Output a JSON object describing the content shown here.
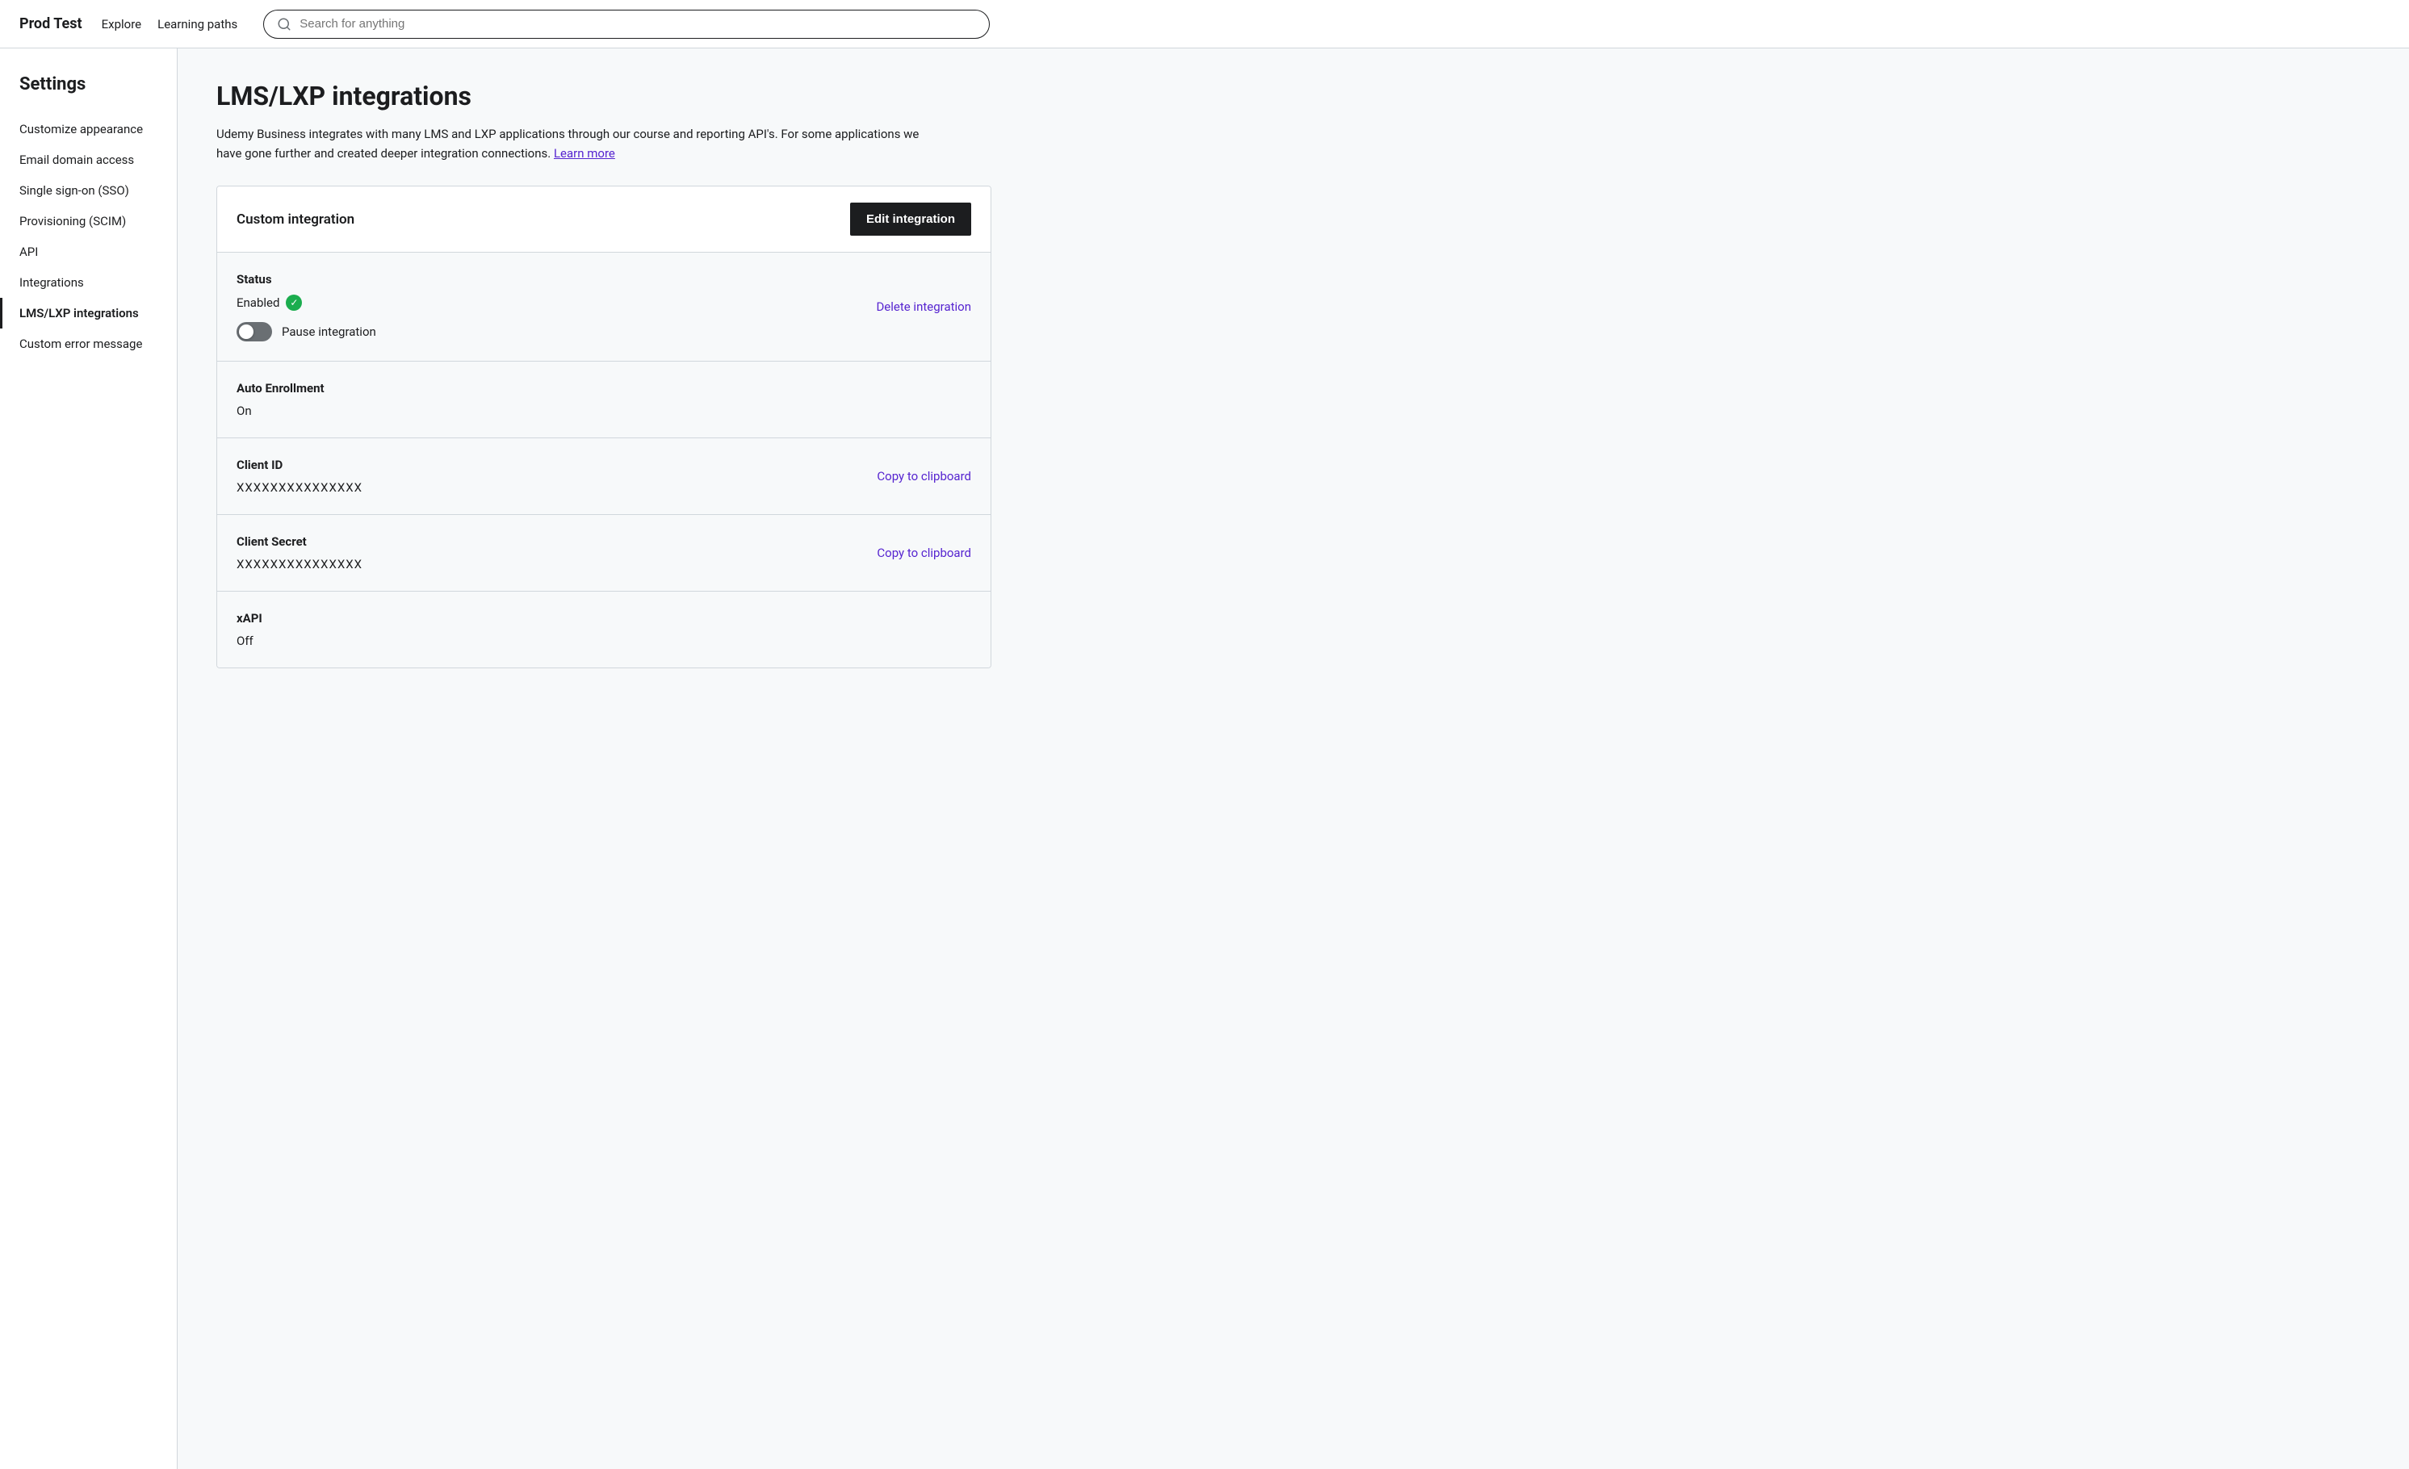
{
  "nav": {
    "brand": "Prod Test",
    "links": [
      "Explore",
      "Learning paths"
    ],
    "search_placeholder": "Search for anything"
  },
  "sidebar": {
    "title": "Settings",
    "items": [
      {
        "label": "Customize appearance",
        "active": false
      },
      {
        "label": "Email domain access",
        "active": false
      },
      {
        "label": "Single sign-on (SSO)",
        "active": false
      },
      {
        "label": "Provisioning (SCIM)",
        "active": false
      },
      {
        "label": "API",
        "active": false
      },
      {
        "label": "Integrations",
        "active": false
      },
      {
        "label": "LMS/LXP integrations",
        "active": true
      },
      {
        "label": "Custom error message",
        "active": false
      }
    ]
  },
  "main": {
    "page_title": "LMS/LXP integrations",
    "description": "Udemy Business integrates with many LMS and LXP applications through our course and reporting API's. For some applications we have gone further and created deeper integration connections.",
    "learn_more": "Learn more",
    "card": {
      "header_title": "Custom integration",
      "edit_button": "Edit integration",
      "sections": [
        {
          "id": "status",
          "label": "Status",
          "enabled_text": "Enabled",
          "pause_label": "Pause integration",
          "delete_link": "Delete integration"
        },
        {
          "id": "auto_enrollment",
          "label": "Auto Enrollment",
          "value": "On"
        },
        {
          "id": "client_id",
          "label": "Client ID",
          "value": "XXXXXXXXXXXXXXX",
          "copy_label": "Copy to clipboard"
        },
        {
          "id": "client_secret",
          "label": "Client Secret",
          "value": "XXXXXXXXXXXXXXX",
          "copy_label": "Copy to clipboard"
        },
        {
          "id": "xapi",
          "label": "xAPI",
          "value": "Off"
        }
      ]
    }
  },
  "colors": {
    "accent": "#5624d0",
    "success": "#1bad4e",
    "dark": "#1c1d1f"
  }
}
